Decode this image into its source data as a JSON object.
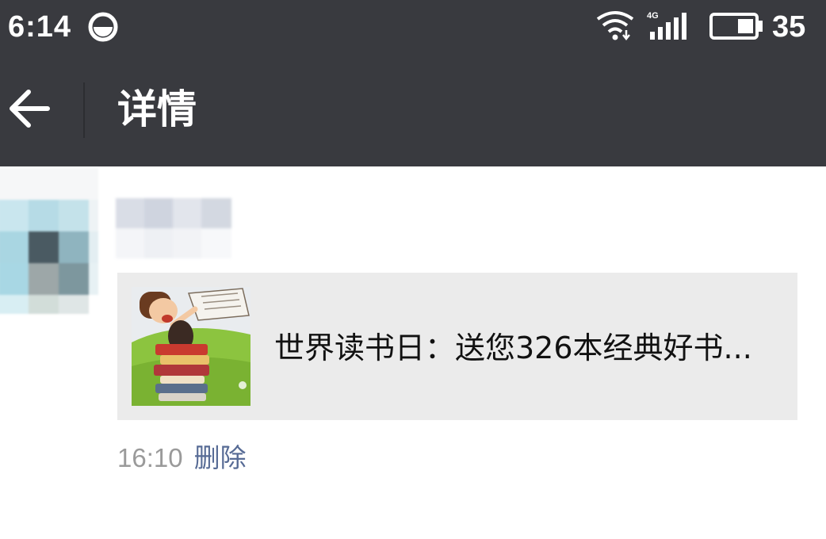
{
  "status_bar": {
    "time": "6:14",
    "network": "4G",
    "battery": "35"
  },
  "header": {
    "title": "详情"
  },
  "post": {
    "share": {
      "title": "世界读书日：送您326本经典好书..."
    },
    "time": "16:10",
    "delete_label": "删除"
  },
  "colors": {
    "header_bg": "#393a3f",
    "card_bg": "#ebebeb",
    "link": "#576b95",
    "time_text": "#9a9a9a"
  },
  "icons": [
    "back-arrow-icon",
    "wifi-icon",
    "signal-icon",
    "battery-icon",
    "status-circle-icon"
  ]
}
